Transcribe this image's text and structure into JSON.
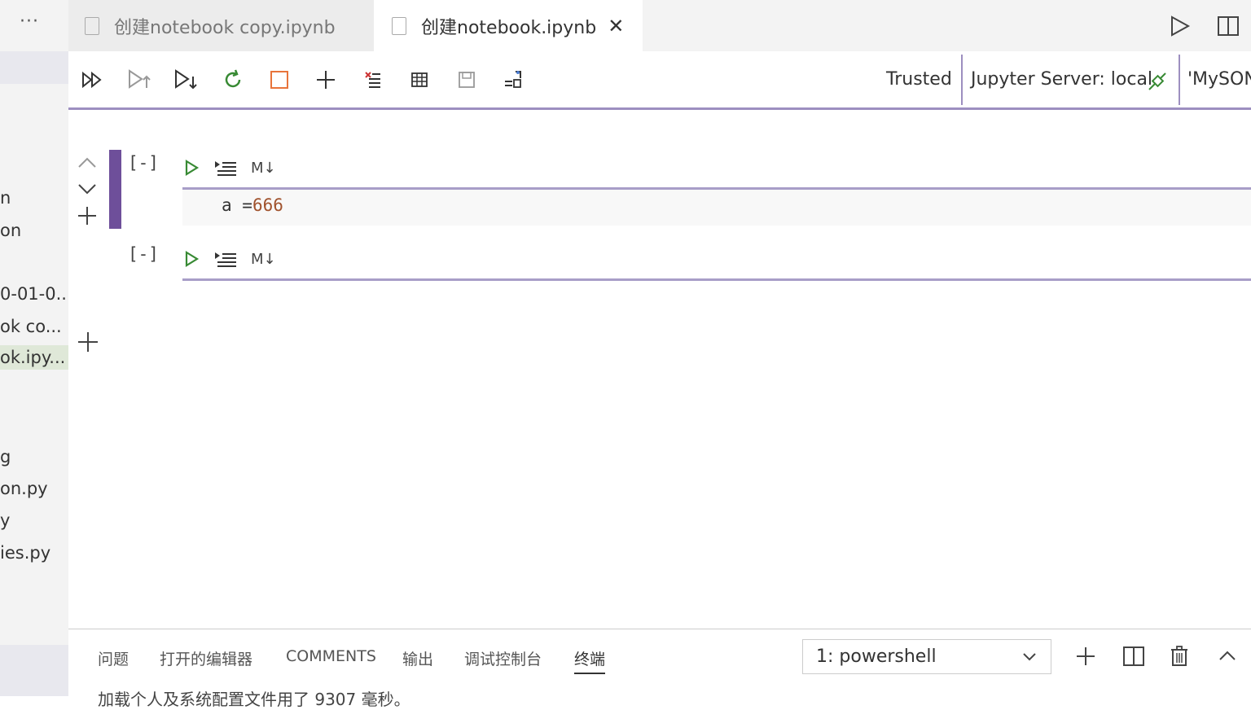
{
  "sidebar": {
    "more_label": "···",
    "items": [
      "n",
      "on",
      "0-01-0...",
      "ok co...",
      "ok.ipy...",
      "g",
      "on.py",
      "y",
      "ies.py"
    ]
  },
  "tabs": [
    {
      "label": "创建notebook copy.ipynb",
      "active": false
    },
    {
      "label": "创建notebook.ipynb",
      "active": true,
      "close": "✕"
    }
  ],
  "toolbar": {
    "trusted": "Trusted",
    "server": "Jupyter Server: local",
    "kernel": "'MySON"
  },
  "cells": [
    {
      "exec_count": "[-]",
      "md_label": "M↓",
      "code_var": "a",
      "code_op": " =",
      "code_num": "666"
    },
    {
      "exec_count": "[-]",
      "md_label": "M↓"
    }
  ],
  "panel": {
    "tabs": [
      "问题",
      "打开的编辑器",
      "COMMENTS",
      "输出",
      "调试控制台",
      "终端"
    ],
    "active_tab": "终端",
    "terminal_select": "1: powershell",
    "terminal_line": "加载个人及系统配置文件用了 9307 毫秒。"
  },
  "colors": {
    "accent": "#6e4f9a",
    "cell_line": "#a89ec8",
    "run_green": "#388a34",
    "stop_orange": "#e8743b",
    "number": "#a0522d"
  }
}
